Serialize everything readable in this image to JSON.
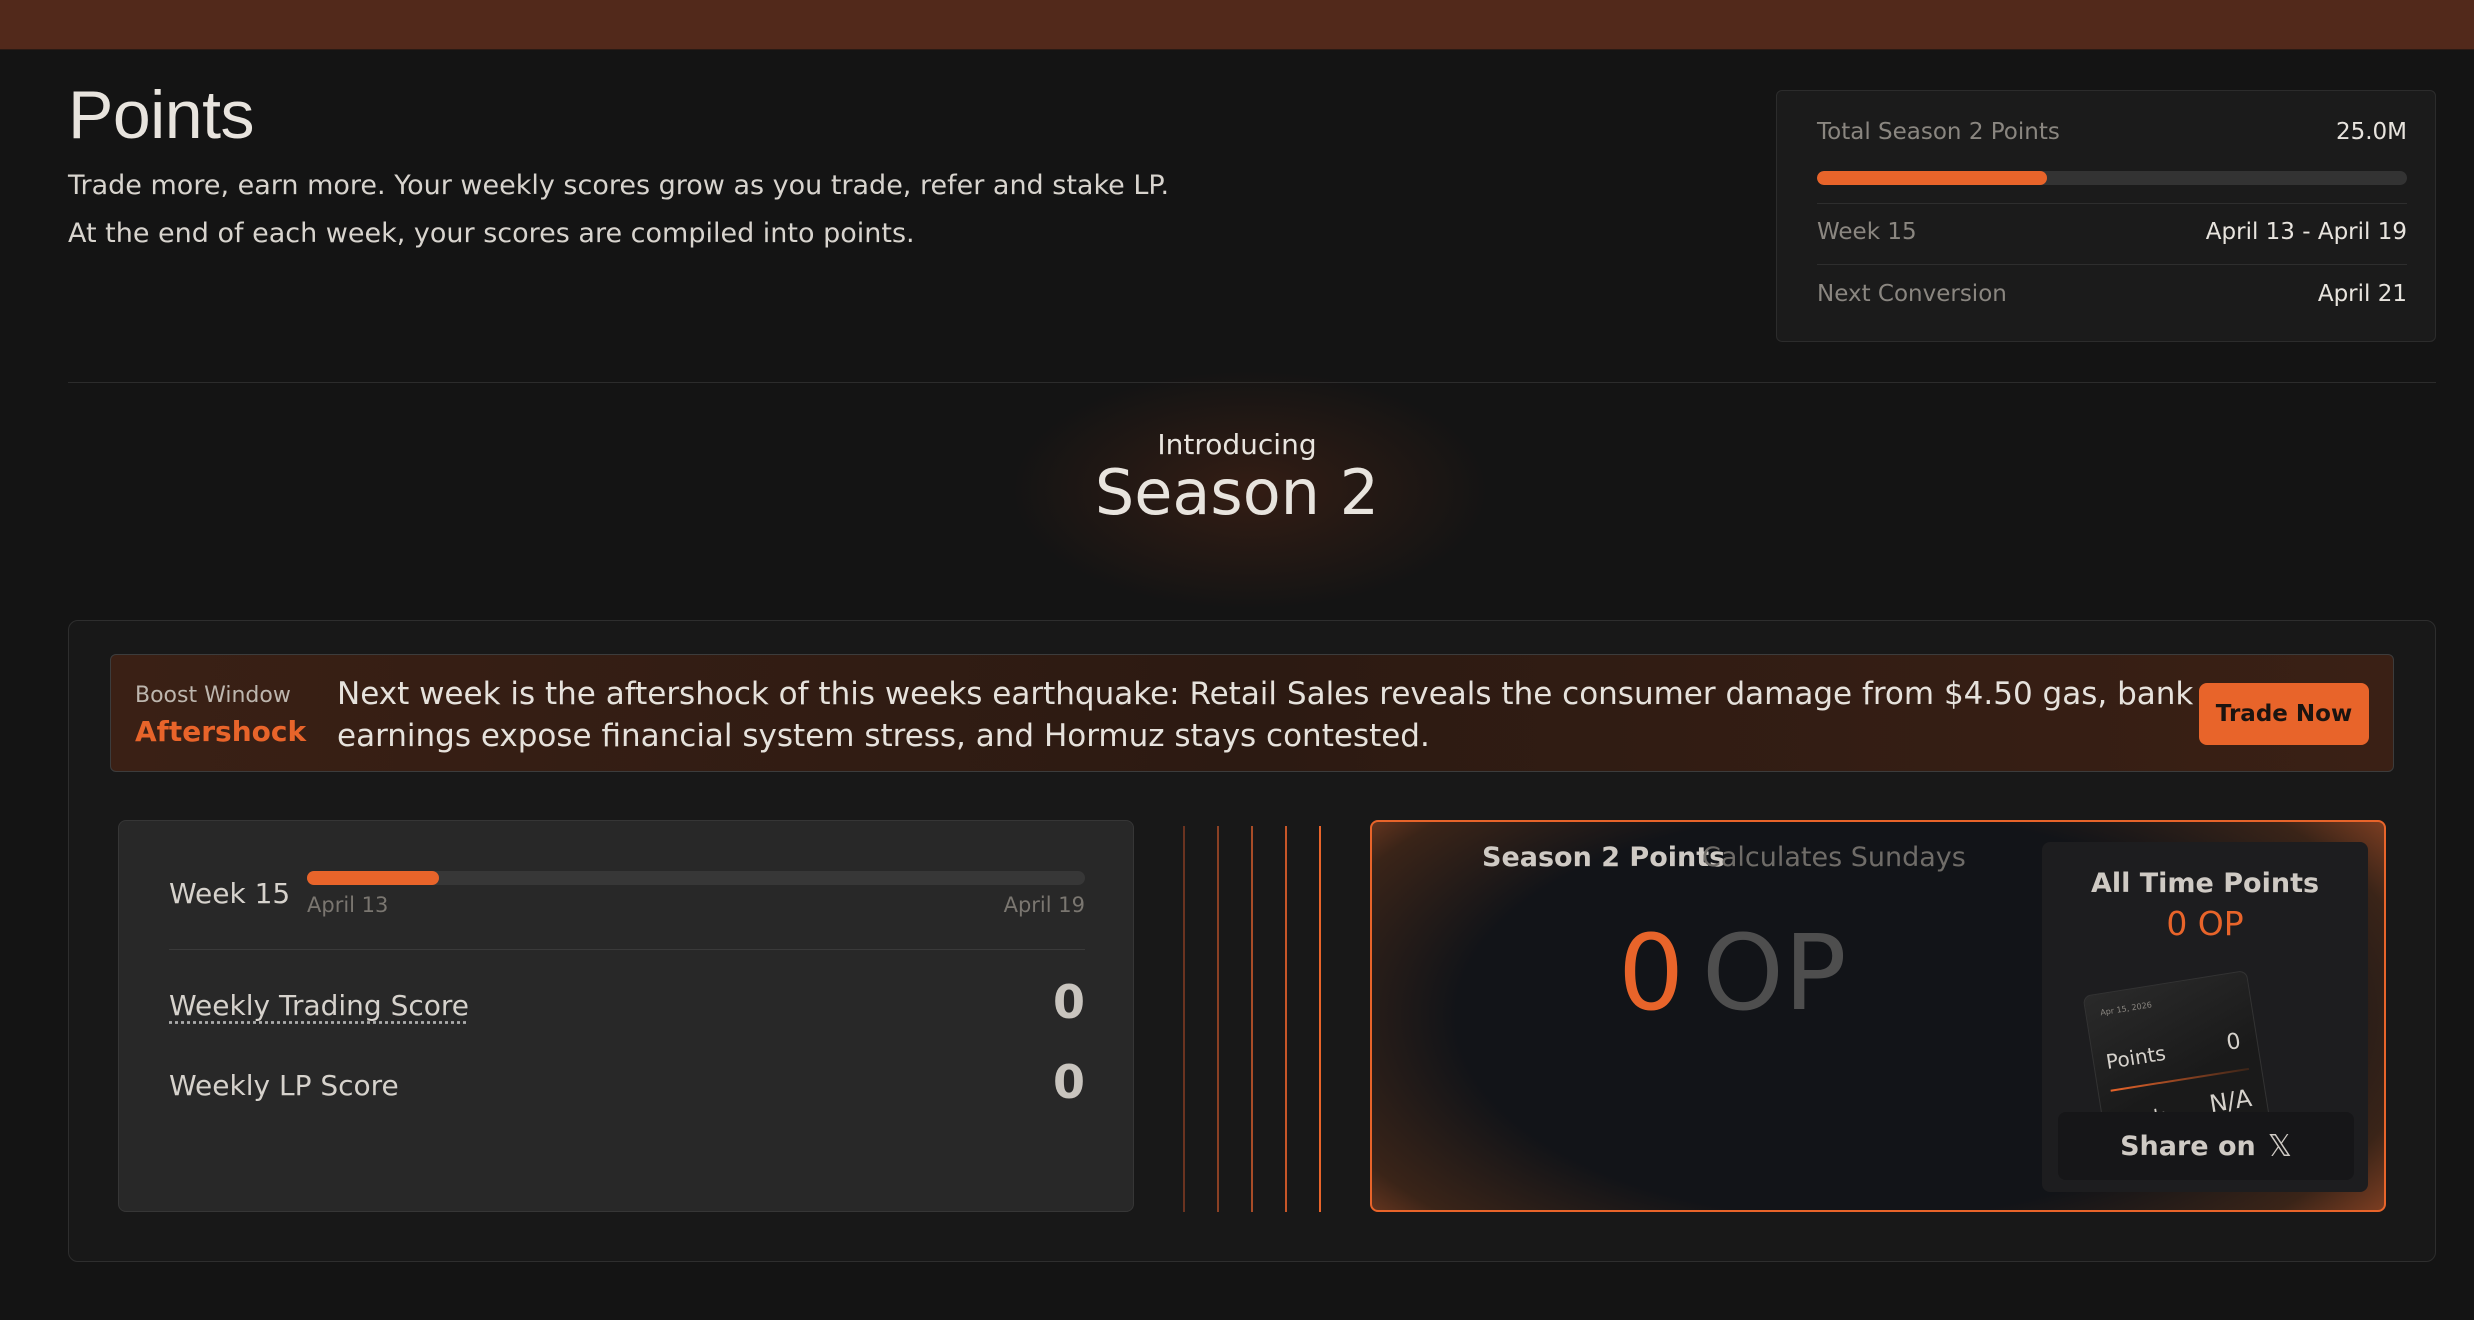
{
  "header": {
    "title": "Points",
    "description": "Trade more, earn more. Your weekly scores grow as you trade, refer and stake LP. At the end of each week, your scores are compiled into points."
  },
  "season_stats": {
    "total_label": "Total Season 2 Points",
    "total_value": "25.0M",
    "progress_fraction": 0.39,
    "week_label": "Week 15",
    "week_range": "April 13 - April 19",
    "next_conversion_label": "Next Conversion",
    "next_conversion_value": "April 21"
  },
  "intro": {
    "small": "Introducing",
    "big": "Season 2"
  },
  "boost": {
    "label": "Boost Window",
    "name": "Aftershock",
    "text": "Next week is the aftershock of this weeks earthquake: Retail Sales reveals the consumer damage from $4.50 gas, bank earnings expose financial system stress, and Hormuz stays contested.",
    "button_label": "Trade Now"
  },
  "weekly": {
    "week_label": "Week 15",
    "progress_fraction": 0.17,
    "start_date": "April 13",
    "end_date": "April 19",
    "trading_label": "Weekly Trading Score",
    "trading_value": "0",
    "lp_label": "Weekly LP Score",
    "lp_value": "0"
  },
  "season_points": {
    "title": "Season 2 Points",
    "subtitle": "Calculates Sundays",
    "value": "0",
    "unit": "OP",
    "all_time_title": "All Time Points",
    "all_time_value": "0 OP",
    "mini_card": {
      "date": "Apr 15, 2026",
      "points_label": "Points",
      "points_value": "0",
      "rank_label": "Rank",
      "rank_value": "N/A"
    },
    "share_label": "Share on",
    "share_icon": "x-logo-icon"
  },
  "colors": {
    "accent": "#e8642a",
    "background": "#141414",
    "topbar": "#52291b"
  }
}
